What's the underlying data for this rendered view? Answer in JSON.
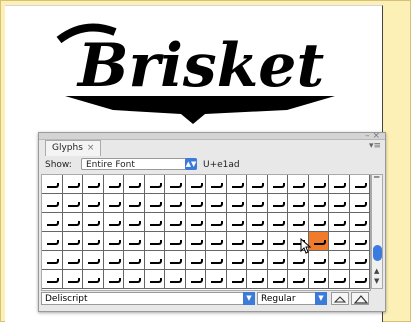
{
  "artwork": {
    "text": "Brisket"
  },
  "panel": {
    "tab_label": "Glyphs",
    "tab_close": "×",
    "collapse_glyph": "– ×",
    "menu_glyph": "▾≡",
    "show_label": "Show:",
    "show_value": "Entire Font",
    "unicode_readout": "U+e1ad",
    "font_family": "Deliscript",
    "font_style": "Regular",
    "selected_cell_row": 3,
    "selected_cell_col": 13
  },
  "grid": {
    "rows": 6,
    "cols": 16
  },
  "colors": {
    "selection": "#f07b2a",
    "accent": "#3d7bd8"
  },
  "icons": [
    "close-icon",
    "panel-menu-icon",
    "dropdown-arrow-icon",
    "zoom-out-icon",
    "zoom-in-icon",
    "cursor-icon",
    "scroll-up-icon",
    "scroll-down-icon"
  ]
}
